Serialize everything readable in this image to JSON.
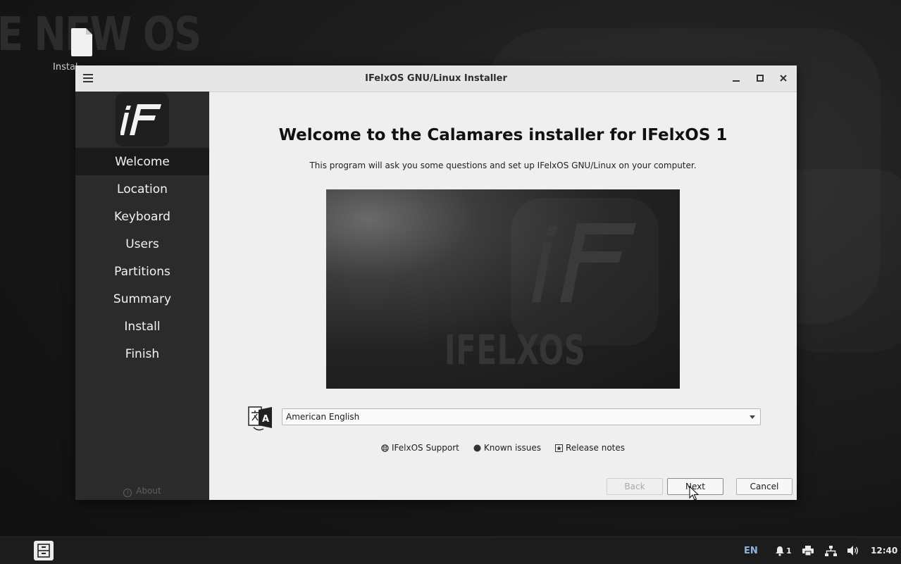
{
  "desktop": {
    "wallpaper_text": "E NEW OS",
    "icon_label": "Instal"
  },
  "window": {
    "title": "IFelxOS GNU/Linux Installer",
    "controls": {
      "menu_icon": "hamburger-icon",
      "minimize_icon": "minimize-icon",
      "maximize_icon": "maximize-icon",
      "close_icon": "close-icon"
    }
  },
  "sidebar": {
    "logo_alt": "iF",
    "items": [
      {
        "label": "Welcome",
        "active": true
      },
      {
        "label": "Location",
        "active": false
      },
      {
        "label": "Keyboard",
        "active": false
      },
      {
        "label": "Users",
        "active": false
      },
      {
        "label": "Partitions",
        "active": false
      },
      {
        "label": "Summary",
        "active": false
      },
      {
        "label": "Install",
        "active": false
      },
      {
        "label": "Finish",
        "active": false
      }
    ],
    "about_label": "About"
  },
  "welcome": {
    "heading": "Welcome to the Calamares installer for IFelxOS 1",
    "subtitle": "This program will ask you some questions and set up IFelxOS GNU/Linux on your computer.",
    "banner_text": "IFELXOS",
    "language": {
      "selected": "American English"
    },
    "links": {
      "support": "IFelxOS Support",
      "known_issues": "Known issues",
      "release_notes": "Release notes"
    }
  },
  "buttons": {
    "back": "Back",
    "next": "Next",
    "cancel": "Cancel"
  },
  "taskbar": {
    "keyboard_layout": "EN",
    "notifications_count": "1",
    "clock": "12:40"
  },
  "colors": {
    "sidebar_bg": "#2b2b2b",
    "sidebar_active": "#1a1a1a",
    "window_bg": "#efefef",
    "keyboard_layout_accent": "#8fb4e0"
  }
}
